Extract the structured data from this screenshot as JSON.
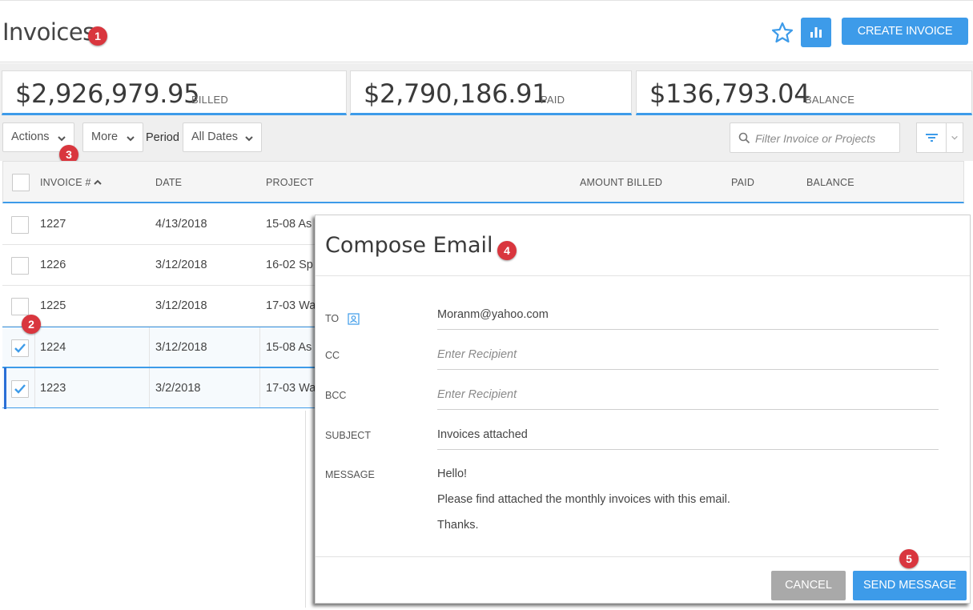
{
  "header": {
    "title": "Invoices",
    "create_label": "CREATE INVOICE"
  },
  "summary": [
    {
      "amount": "$2,926,979.95",
      "label": "BILLED"
    },
    {
      "amount": "$2,790,186.91",
      "label": "PAID"
    },
    {
      "amount": "$136,793.04",
      "label": "BALANCE"
    }
  ],
  "toolbar": {
    "actions_label": "Actions",
    "more_label": "More",
    "period_label": "Period",
    "period_value": "All Dates",
    "filter_placeholder": "Filter Invoice or Projects"
  },
  "table": {
    "columns": [
      "INVOICE #",
      "DATE",
      "PROJECT",
      "AMOUNT BILLED",
      "PAID",
      "BALANCE"
    ],
    "rows": [
      {
        "invoice": "1227",
        "date": "4/13/2018",
        "project": "15-08 As",
        "checked": false
      },
      {
        "invoice": "1226",
        "date": "3/12/2018",
        "project": "16-02 Sp",
        "checked": false
      },
      {
        "invoice": "1225",
        "date": "3/12/2018",
        "project": "17-03 Wa",
        "checked": false
      },
      {
        "invoice": "1224",
        "date": "3/12/2018",
        "project": "15-08 As",
        "checked": true
      },
      {
        "invoice": "1223",
        "date": "3/2/2018",
        "project": "17-03 Wa",
        "checked": true
      }
    ]
  },
  "dialog": {
    "title": "Compose Email",
    "to_label": "TO",
    "to_value": "Moranm@yahoo.com",
    "cc_label": "CC",
    "cc_placeholder": "Enter Recipient",
    "bcc_label": "BCC",
    "bcc_placeholder": "Enter Recipient",
    "subject_label": "SUBJECT",
    "subject_value": "Invoices attached",
    "message_label": "MESSAGE",
    "message_lines": [
      "Hello!",
      "Please find attached the monthly invoices with this email.",
      "Thanks."
    ],
    "cancel_label": "CANCEL",
    "send_label": "SEND MESSAGE"
  },
  "badges": [
    "1",
    "2",
    "3",
    "4",
    "5"
  ],
  "colors": {
    "accent": "#3d9be9",
    "badge": "#d9363e",
    "cancel": "#a9a9a9"
  },
  "icons": [
    "star-icon",
    "bar-chart-icon",
    "chevron-down-icon",
    "search-icon",
    "filter-icon",
    "contact-icon",
    "checkmark-icon",
    "sort-up-icon"
  ]
}
